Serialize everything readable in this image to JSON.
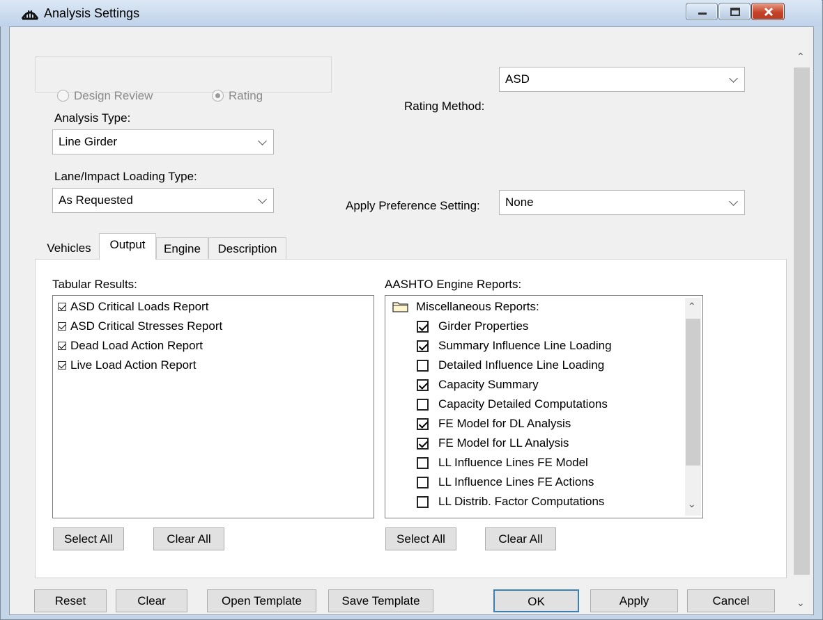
{
  "window": {
    "title": "Analysis Settings",
    "icon": "bridge-icon"
  },
  "mode": {
    "design_review_label": "Design Review",
    "rating_label": "Rating",
    "selected": "Rating"
  },
  "rating_method": {
    "label": "Rating Method:",
    "value": "ASD"
  },
  "analysis_type": {
    "label": "Analysis Type:",
    "value": "Line Girder"
  },
  "lane_impact": {
    "label": "Lane/Impact Loading Type:",
    "value": "As Requested"
  },
  "preference": {
    "label": "Apply Preference Setting:",
    "value": "None"
  },
  "tabs": [
    {
      "label": "Vehicles",
      "active": false
    },
    {
      "label": "Output",
      "active": true
    },
    {
      "label": "Engine",
      "active": false
    },
    {
      "label": "Description",
      "active": false
    }
  ],
  "tabular": {
    "label": "Tabular Results:",
    "items": [
      {
        "label": "ASD Critical Loads Report",
        "checked": true
      },
      {
        "label": "ASD Critical Stresses Report",
        "checked": true
      },
      {
        "label": "Dead Load Action Report",
        "checked": true
      },
      {
        "label": "Live Load Action Report",
        "checked": true
      }
    ],
    "select_all": "Select All",
    "clear_all": "Clear All"
  },
  "engine_reports": {
    "label": "AASHTO Engine Reports:",
    "folder": "Miscellaneous Reports:",
    "items": [
      {
        "label": "Girder Properties",
        "checked": true
      },
      {
        "label": "Summary Influence Line Loading",
        "checked": true
      },
      {
        "label": "Detailed Influence Line Loading",
        "checked": false
      },
      {
        "label": "Capacity Summary",
        "checked": true
      },
      {
        "label": "Capacity Detailed Computations",
        "checked": false
      },
      {
        "label": "FE Model for DL Analysis",
        "checked": true
      },
      {
        "label": "FE Model for LL Analysis",
        "checked": true
      },
      {
        "label": "LL Influence Lines FE Model",
        "checked": false
      },
      {
        "label": "LL Influence Lines FE Actions",
        "checked": false
      },
      {
        "label": "LL Distrib. Factor Computations",
        "checked": false
      }
    ],
    "select_all": "Select All",
    "clear_all": "Clear All"
  },
  "buttons": {
    "reset": "Reset",
    "clear": "Clear",
    "open_template": "Open Template",
    "save_template": "Save Template",
    "ok": "OK",
    "apply": "Apply",
    "cancel": "Cancel"
  },
  "colors": {
    "title_bar": "#c5d5e8",
    "close_button": "#c4432b",
    "dialog_bg": "#f0f0f0",
    "ok_border": "#3c7fb1"
  }
}
